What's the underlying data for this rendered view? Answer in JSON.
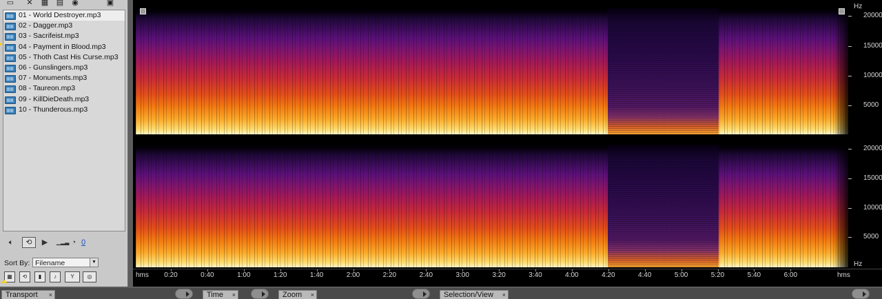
{
  "files": {
    "toolbar": [
      {
        "name": "open-file-icon",
        "glyph": "▭"
      },
      {
        "name": "close-file-icon",
        "glyph": "✕"
      },
      {
        "name": "multitrack-icon",
        "glyph": "▦"
      },
      {
        "name": "cd-icon",
        "glyph": "▤"
      },
      {
        "name": "insert-icon",
        "glyph": "◉"
      },
      {
        "name": "panel-menu-icon",
        "glyph": "▣"
      }
    ],
    "items": [
      "01 - World Destroyer.mp3",
      "02 - Dagger.mp3",
      "03 - Sacrifeist.mp3",
      "04 - Payment in Blood.mp3",
      "05 - Thoth Cast His Curse.mp3",
      "06 - Gunslingers.mp3",
      "07 - Monuments.mp3",
      "08 - Taureon.mp3",
      "09 - KillDieDeath.mp3",
      "10 - Thunderous.mp3"
    ],
    "selected_index": 0,
    "preview": {
      "speaker_icon": "speaker-icon",
      "loop_icon": "loop-icon",
      "play_icon": "play-icon",
      "volume_icon": "volume-icon",
      "knob_icon": "knob-icon",
      "level_value": "0"
    },
    "sort_label": "Sort By:",
    "sort_value": "Filename"
  },
  "spectral": {
    "freq_unit": "Hz",
    "freq_labels": [
      "20000",
      "15000",
      "10000",
      "5000"
    ],
    "time_unit": "hms",
    "time_labels": [
      "0:20",
      "0:40",
      "1:00",
      "1:20",
      "1:40",
      "2:00",
      "2:20",
      "2:40",
      "3:00",
      "3:20",
      "3:40",
      "4:00",
      "4:20",
      "4:40",
      "5:00",
      "5:20",
      "5:40",
      "6:00"
    ]
  },
  "panels": {
    "transport": "Transport",
    "time": "Time",
    "zoom": "Zoom",
    "selection_view": "Selection/View",
    "close_glyph": "×"
  },
  "colors": {
    "spectrum_low": "#000000",
    "spectrum_mid": "#a0185a",
    "spectrum_high": "#fff6c8",
    "playhead": "#f2d11c"
  }
}
